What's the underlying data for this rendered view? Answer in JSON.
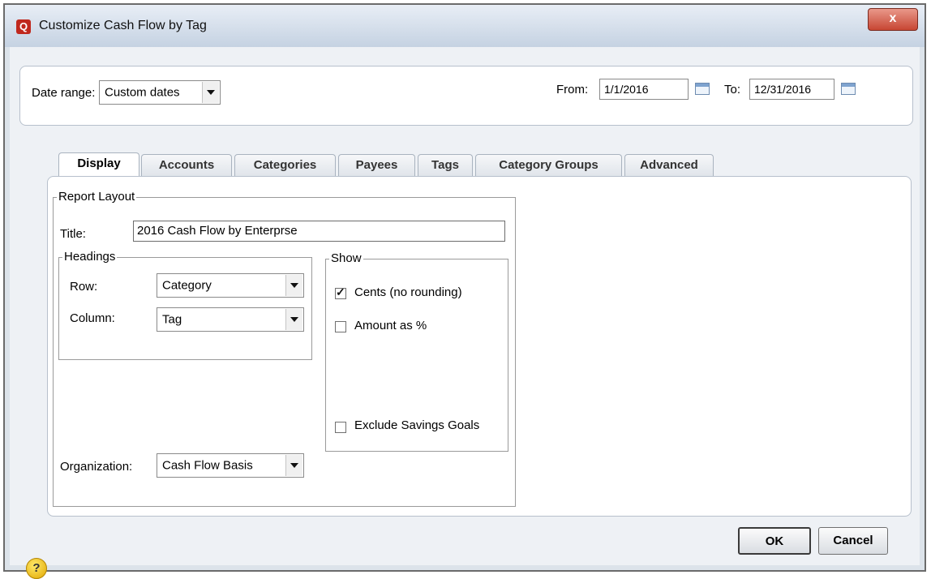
{
  "window": {
    "title": "Customize Cash Flow by Tag",
    "close_label": "x",
    "app_icon": "Q"
  },
  "date_range": {
    "label": "Date range:",
    "value": "Custom dates",
    "from_label": "From:",
    "from_value": "1/1/2016",
    "to_label": "To:",
    "to_value": "12/31/2016"
  },
  "tabs": [
    "Display",
    "Accounts",
    "Categories",
    "Payees",
    "Tags",
    "Category Groups",
    "Advanced"
  ],
  "active_tab": "Display",
  "report_layout": {
    "group_label": "Report Layout",
    "title_label": "Title:",
    "title_value": "2016 Cash Flow by Enterprse",
    "headings": {
      "group_label": "Headings",
      "row_label": "Row:",
      "row_value": "Category",
      "column_label": "Column:",
      "column_value": "Tag"
    },
    "organization_label": "Organization:",
    "organization_value": "Cash Flow Basis"
  },
  "show": {
    "group_label": "Show",
    "cents_label": "Cents (no rounding)",
    "cents_checked": true,
    "amount_label": "Amount as %",
    "amount_checked": false,
    "exclude_label": "Exclude Savings Goals",
    "exclude_checked": false
  },
  "buttons": {
    "ok": "OK",
    "cancel": "Cancel",
    "help": "?"
  },
  "colors": {
    "close_button": "#c74633",
    "app_icon": "#c0281d",
    "help_icon": "#f2c300"
  }
}
